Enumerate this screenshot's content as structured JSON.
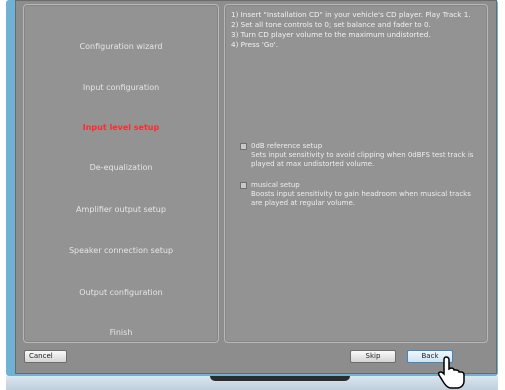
{
  "sidebar": {
    "items": [
      {
        "label": "Configuration wizard"
      },
      {
        "label": "Input configuration"
      },
      {
        "label": "Input level setup"
      },
      {
        "label": "De-equalization"
      },
      {
        "label": "Amplifier output setup"
      },
      {
        "label": "Speaker connection setup"
      },
      {
        "label": "Output configuration"
      },
      {
        "label": "Finish"
      }
    ],
    "active_index": 2
  },
  "instructions": [
    "1) Insert \"Installation CD\" in your vehicle's CD player. Play Track 1.",
    "2) Set all tone controls to 0; set balance and fader to 0.",
    "3) Turn CD player volume to the maximum undistorted.",
    "4) Press 'Go'."
  ],
  "options": [
    {
      "label": "0dB reference setup",
      "desc1": "Sets input sensitivity to avoid clipping when 0dBFS test track is",
      "desc2": "played at max undistorted volume."
    },
    {
      "label": "musical setup",
      "desc1": "Boosts input sensitivity to gain headroom when musical tracks",
      "desc2": "are played at regular volume."
    }
  ],
  "buttons": {
    "cancel": "Cancel",
    "skip": "Skip",
    "back": "Back"
  },
  "colors": {
    "active": "#ff2a2a",
    "panel": "#939393",
    "accent": "#3a88c8"
  }
}
